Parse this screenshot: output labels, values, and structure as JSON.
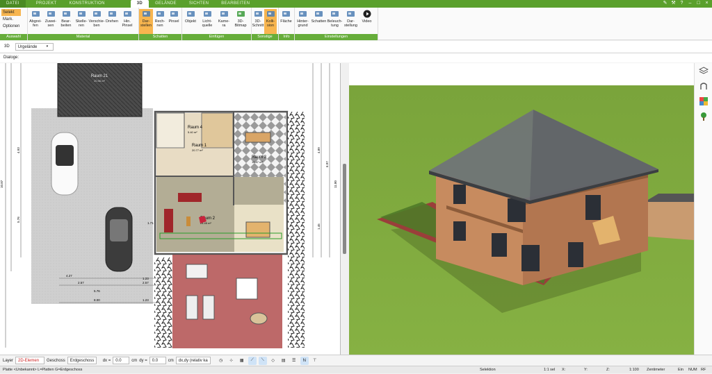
{
  "tabs": [
    "DATEI",
    "PROJEKT",
    "KONSTRUKTION",
    "3D",
    "GELÄNDE",
    "SICHTEN",
    "BEARBEITEN"
  ],
  "active_tab": "3D",
  "selection": {
    "items": [
      "Selekt",
      "Mark.",
      "Optionen"
    ],
    "label": "Auswahl"
  },
  "groups": [
    {
      "label": "Material",
      "buttons": [
        "Abgrei-\nfen",
        "Zuwei-\nsen",
        "Bear-\nbeiten",
        "Skelle-\nren",
        "Verschie-\nben",
        "Drehen",
        "Hin.\nPinsel"
      ]
    },
    {
      "label": "Schatten",
      "buttons": [
        "Dar-\nstellen",
        "Rech-\nnen",
        "Pinsel"
      ]
    },
    {
      "label": "Einfügen",
      "buttons": [
        "Objekt",
        "Licht-\nquelle",
        "Kame-\nra",
        "3D-\nBitmap"
      ]
    },
    {
      "label": "Sonstige",
      "buttons": [
        "3D-\nSchnitt",
        "Kolli-\nsion"
      ]
    },
    {
      "label": "Info",
      "buttons": [
        "Fläche"
      ]
    },
    {
      "label": "Einstellungen",
      "buttons": [
        "Hinter-\ngrund",
        "Schatten",
        "Beleuch-\ntung",
        "Dar-\nstellung",
        "Video"
      ]
    }
  ],
  "viewbar": {
    "mode": "3D",
    "terrain": "Urgelände"
  },
  "dialog_label": "Dialoge:",
  "plan": {
    "rooms": [
      {
        "name": "Raum 21",
        "area": "20.96 m²"
      },
      {
        "name": "Raum 4",
        "area": "5.40 m²"
      },
      {
        "name": "Raum 1",
        "area": "20.77 m²"
      },
      {
        "name": "Raum 3",
        "area": "15.87 m²"
      },
      {
        "name": "Raum 2",
        "area": "24.45 m²"
      }
    ],
    "dims": [
      "4.27",
      "2.57",
      "5.76",
      "8.00",
      "1.23",
      "1.23",
      "2.57",
      "10.87",
      "11.00",
      "4.93",
      "5.76",
      "1.71",
      "4.89",
      "1.45",
      "6.97",
      "1.71"
    ]
  },
  "bottom": {
    "layer_label": "Layer",
    "layer_value": "2D-Elemen",
    "floor_label": "Geschoss",
    "floor_value": "Erdgeschoss",
    "dx_label": "dx =",
    "dx_value": "0.0",
    "dy_label": "dy =",
    "dy_value": "0.0",
    "unit": "cm",
    "mode": "dx,dy (relativ ka"
  },
  "status": {
    "left": "Platte <Unbekannt> L=Platten G=Erdgeschoss",
    "sel": "Selektion",
    "count": "1:1 sel",
    "x": "X:",
    "y": "Y:",
    "z": "Z:",
    "scale": "1:100",
    "unit": "Zentimeter",
    "ein": "Ein",
    "num": "NUM",
    "rf": "RF"
  },
  "colors": {
    "green": "#5aa02c",
    "orange": "#f7b54f"
  }
}
